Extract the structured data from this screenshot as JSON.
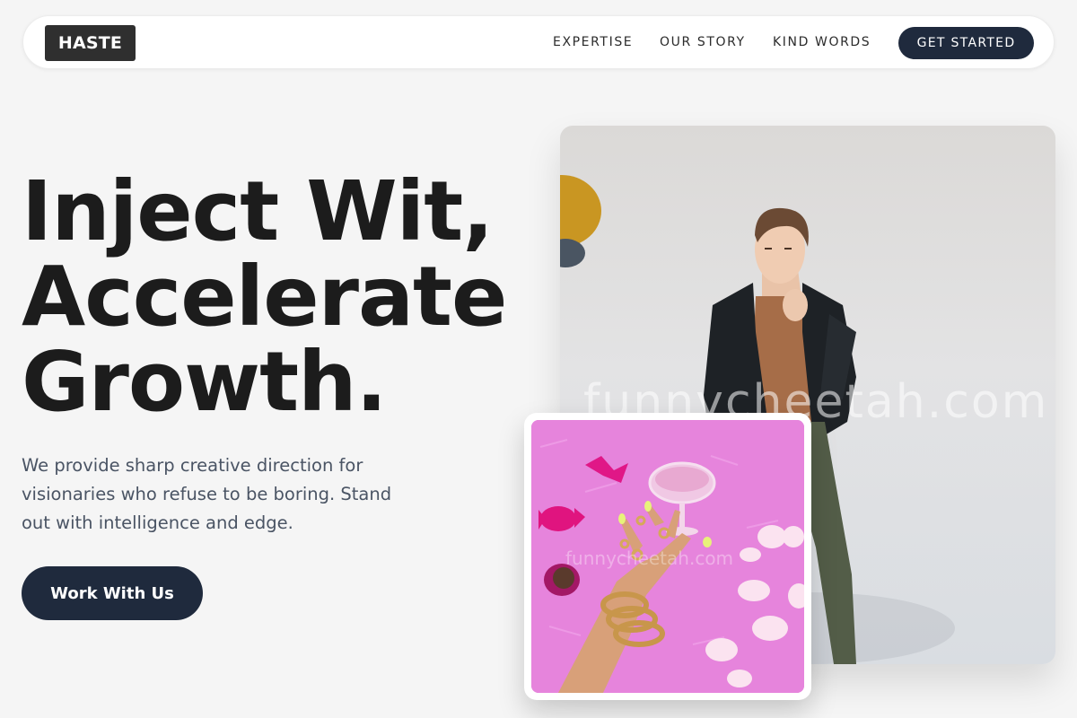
{
  "nav": {
    "logo": "HASTE",
    "links": [
      "EXPERTISE",
      "OUR STORY",
      "KIND WORDS"
    ],
    "cta": "GET STARTED"
  },
  "hero": {
    "title_lines": [
      "Inject Wit,",
      "Accelerate",
      "Growth."
    ],
    "description": "We provide sharp creative direction for visionaries who refuse to be boring. Stand out with intelligence and edge.",
    "cta": "Work With Us"
  },
  "images": {
    "main_watermark": "funnycheetah.com",
    "card_watermark": "funnycheetah.com"
  },
  "colors": {
    "background": "#f5f5f5",
    "primary_button": "#1f2a3d",
    "logo_bg": "#2f2f2f",
    "description_text": "#4a5464"
  }
}
